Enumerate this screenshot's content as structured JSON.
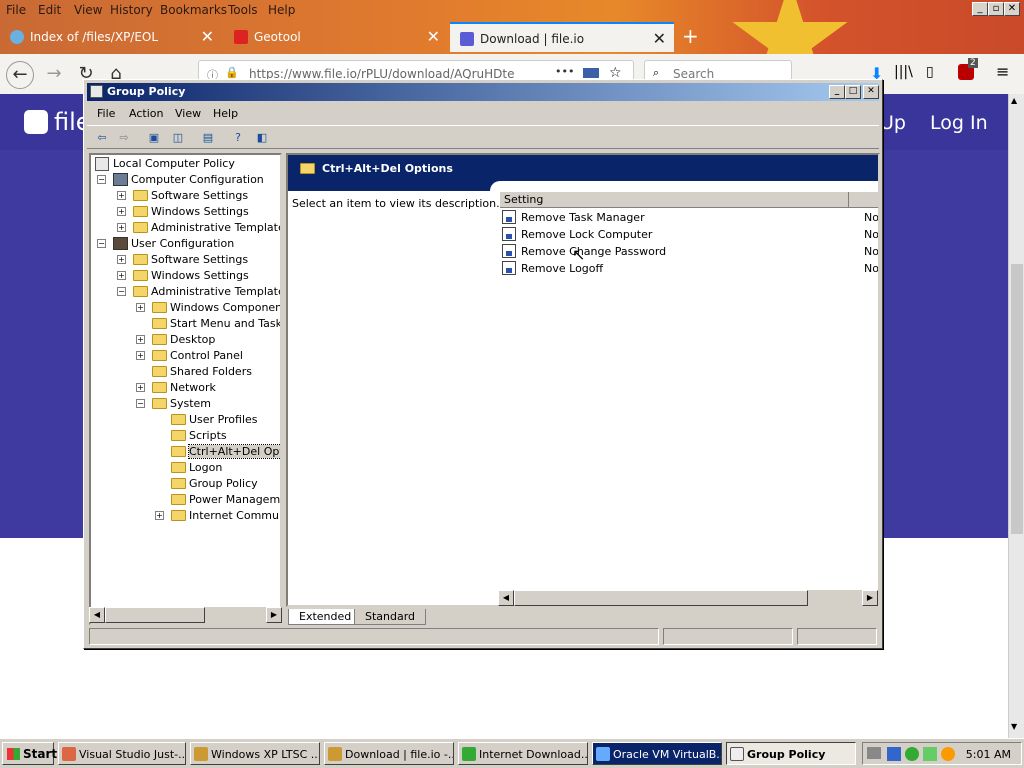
{
  "browser": {
    "menu": [
      "File",
      "Edit",
      "View",
      "History",
      "Bookmarks",
      "Tools",
      "Help"
    ],
    "tabs": [
      {
        "label": "Index of /files/XP/EOL"
      },
      {
        "label": "Geotool"
      },
      {
        "label": "Download | file.io"
      }
    ],
    "url": "https://www.file.io/rPLU/download/AQruHDte",
    "search_placeholder": "Search",
    "badge": "2"
  },
  "fileio": {
    "logo_text": "file",
    "signup_partial": "Up",
    "login": "Log In"
  },
  "gp": {
    "title": "Group Policy",
    "menu": [
      "File",
      "Action",
      "View",
      "Help"
    ],
    "tree": [
      {
        "label": "Local Computer Policy"
      },
      {
        "label": "Computer Configuration"
      },
      {
        "label": "Software Settings"
      },
      {
        "label": "Windows Settings"
      },
      {
        "label": "Administrative Templates"
      },
      {
        "label": "User Configuration"
      },
      {
        "label": "Software Settings"
      },
      {
        "label": "Windows Settings"
      },
      {
        "label": "Administrative Templates"
      },
      {
        "label": "Windows Components"
      },
      {
        "label": "Start Menu and Taskba"
      },
      {
        "label": "Desktop"
      },
      {
        "label": "Control Panel"
      },
      {
        "label": "Shared Folders"
      },
      {
        "label": "Network"
      },
      {
        "label": "System"
      },
      {
        "label": "User Profiles"
      },
      {
        "label": "Scripts"
      },
      {
        "label": "Ctrl+Alt+Del Optio"
      },
      {
        "label": "Logon"
      },
      {
        "label": "Group Policy"
      },
      {
        "label": "Power Managemen"
      },
      {
        "label": "Internet Communic"
      }
    ],
    "pane_title": "Ctrl+Alt+Del Options",
    "description": "Select an item to view its description.",
    "column": "Setting",
    "settings": [
      {
        "name": "Remove Task Manager",
        "state": "Not"
      },
      {
        "name": "Remove Lock Computer",
        "state": "Not"
      },
      {
        "name": "Remove Change Password",
        "state": "Not"
      },
      {
        "name": "Remove Logoff",
        "state": "Not"
      }
    ],
    "view_tabs": [
      "Extended",
      "Standard"
    ]
  },
  "taskbar": {
    "start": "Start",
    "items": [
      {
        "label": "Visual Studio Just-..."
      },
      {
        "label": "Windows XP LTSC ..."
      },
      {
        "label": "Download | file.io -..."
      },
      {
        "label": "Internet Download..."
      },
      {
        "label": "Oracle VM VirtualB..."
      },
      {
        "label": "Group Policy"
      }
    ],
    "clock": "5:01 AM"
  },
  "colors": {
    "xp_title": "#0a246a",
    "fileio_bg": "#3f3aa0",
    "firefox_accent": "#0a84ff"
  }
}
